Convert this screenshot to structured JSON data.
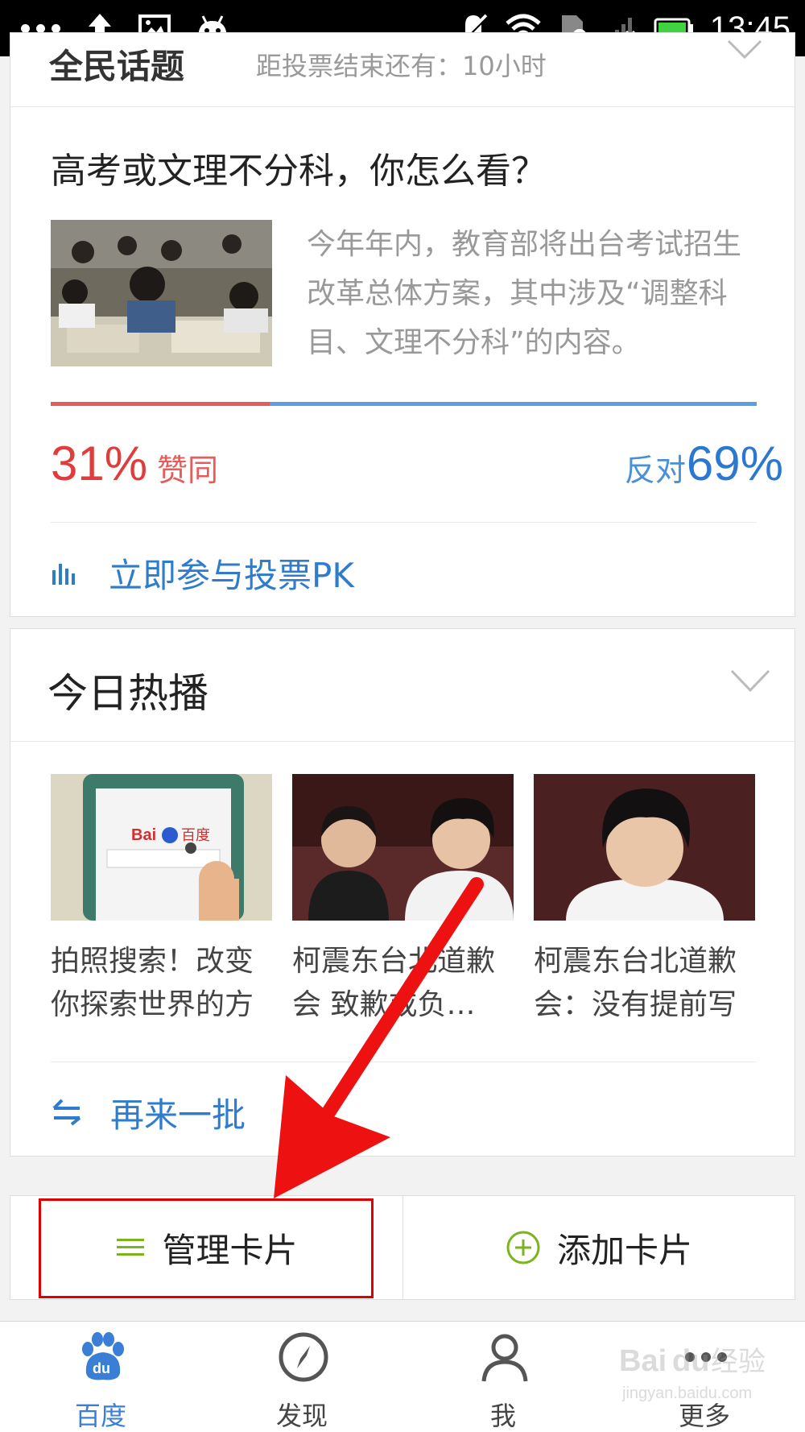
{
  "status_bar": {
    "time": "13:45"
  },
  "vote_card": {
    "header_title": "全民话题",
    "header_sub": "距投票结束还有：10小时",
    "question": "高考或文理不分科，你怎么看？",
    "description": "今年年内，教育部将出台考试招生改革总体方案，其中涉及“调整科目、文理不分科”的内容。",
    "yes_fraction": 0.31,
    "yes_percent": "31%",
    "yes_label": "赞同",
    "no_label": "反对",
    "no_percent": "69%",
    "vote_link": "立即参与投票PK",
    "colors": {
      "yes": "#e03c3c",
      "no": "#2a78d0",
      "link": "#2f7ccc"
    }
  },
  "hot_card": {
    "title": "今日热播",
    "items": [
      {
        "caption": "拍照搜索！改变你探索世界的方",
        "thumb": "phone-baidu-image"
      },
      {
        "caption": "柯震东台北道歉会 致歉或负…",
        "thumb": "press-conference-image"
      },
      {
        "caption": "柯震东台北道歉会：没有提前写",
        "thumb": "portrait-image"
      }
    ],
    "refresh_link": "再来一批"
  },
  "manage_bar": {
    "manage_label": "管理卡片",
    "add_label": "添加卡片",
    "accent": "#7ab51d"
  },
  "bottom_nav": {
    "items": [
      {
        "label": "百度",
        "icon": "baidu-paw-icon",
        "active": true
      },
      {
        "label": "发现",
        "icon": "compass-icon",
        "active": false
      },
      {
        "label": "我",
        "icon": "person-icon",
        "active": false
      },
      {
        "label": "更多",
        "icon": "more-icon",
        "active": false
      }
    ],
    "active_color": "#3a7fd5"
  },
  "watermark": {
    "text": "Baidu经验",
    "sub": "jingyan.baidu.com"
  },
  "annotation": {
    "highlight_color": "#e00000"
  }
}
